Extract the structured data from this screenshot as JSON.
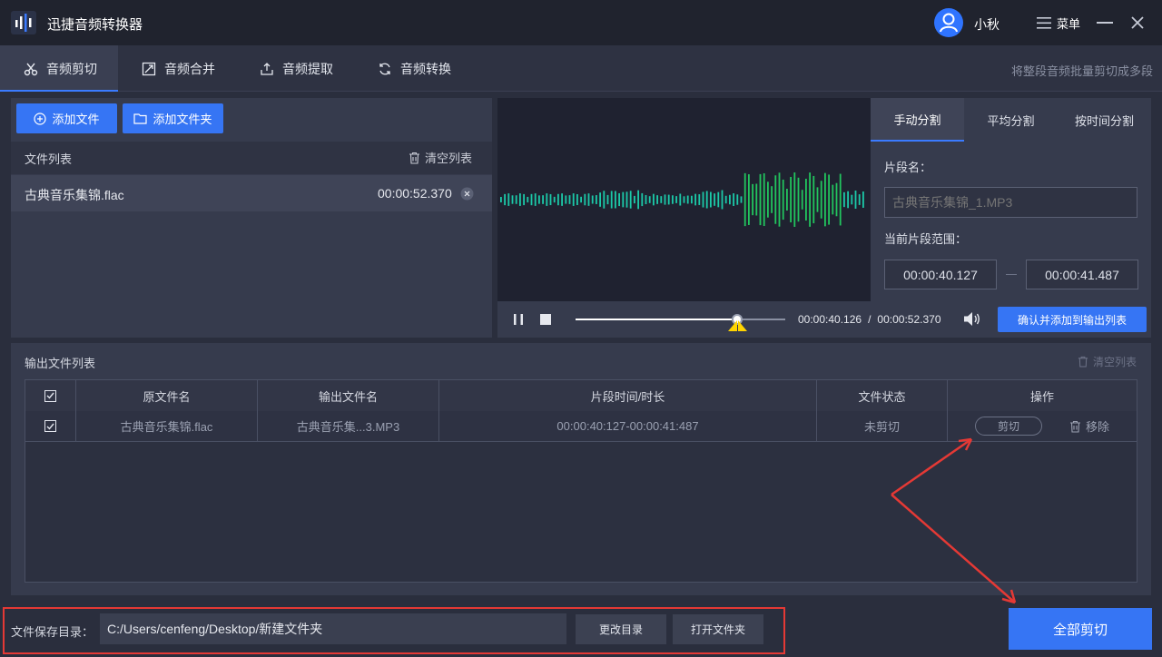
{
  "app": {
    "title": "迅捷音频转换器",
    "username": "小秋",
    "menu_label": "菜单"
  },
  "tabs": [
    {
      "label": "音频剪切",
      "icon": "scissors-icon",
      "active": true
    },
    {
      "label": "音频合并",
      "icon": "merge-icon"
    },
    {
      "label": "音频提取",
      "icon": "extract-icon"
    },
    {
      "label": "音频转换",
      "icon": "convert-icon"
    }
  ],
  "tab_hint": "将整段音频批量剪切成多段",
  "left": {
    "add_file": "添加文件",
    "add_folder": "添加文件夹",
    "list_title": "文件列表",
    "clear_list": "清空列表",
    "files": [
      {
        "name": "古典音乐集锦.flac",
        "duration": "00:00:52.370"
      }
    ]
  },
  "split_tabs": [
    "手动分割",
    "平均分割",
    "按时间分割"
  ],
  "split": {
    "segment_name_label": "片段名：",
    "segment_name_placeholder": "古典音乐集锦_1.MP3",
    "range_label": "当前片段范围：",
    "range_start": "00:00:40.127",
    "range_end": "00:00:41.487",
    "confirm_button": "确认并添加到输出列表"
  },
  "player": {
    "current_time": "00:00:40.126",
    "separator": "/",
    "total_time": "00:00:52.370",
    "progress": 0.77
  },
  "output": {
    "title": "输出文件列表",
    "clear_list": "清空列表",
    "columns": [
      "原文件名",
      "输出文件名",
      "片段时间/时长",
      "文件状态",
      "操作"
    ],
    "rows": [
      {
        "source": "古典音乐集锦.flac",
        "output": "古典音乐集...3.MP3",
        "time": "00:00:40:127-00:00:41:487",
        "status": "未剪切",
        "cut": "剪切",
        "remove": "移除"
      }
    ]
  },
  "bottom": {
    "save_label": "文件保存目录：",
    "save_path": "C:/Users/cenfeng/Desktop/新建文件夹",
    "change_dir": "更改目录",
    "open_folder": "打开文件夹",
    "cut_all": "全部剪切"
  },
  "colors": {
    "accent": "#3675f4",
    "wave_green": "#22c55e",
    "wave_teal": "#1cc9a8",
    "marker": "#ffd400",
    "annotation_red": "#e53935"
  }
}
